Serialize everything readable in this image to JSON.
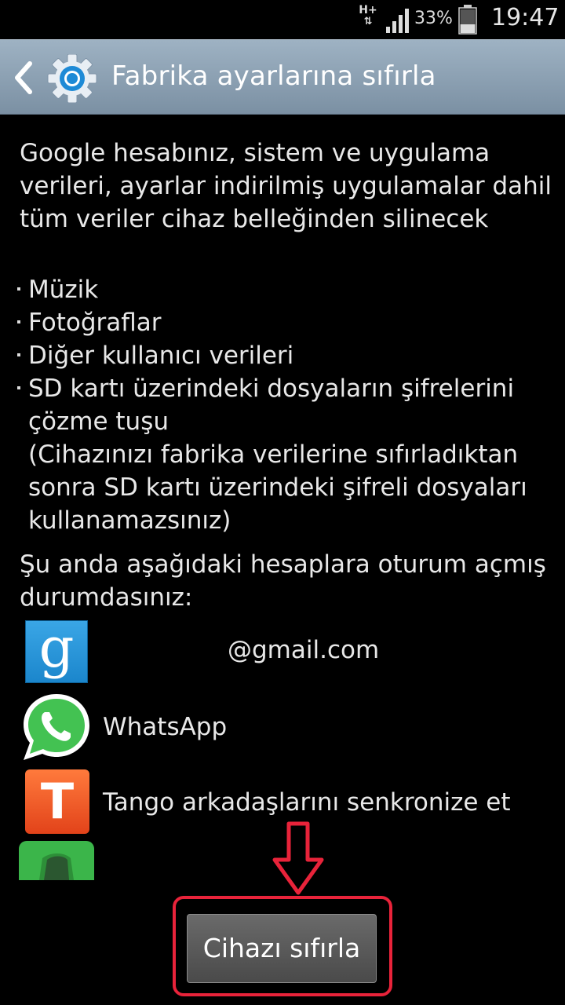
{
  "status_bar": {
    "network": "H+",
    "battery_percent": "33%",
    "time": "19:47"
  },
  "action_bar": {
    "title": "Fabrika ayarlarına sıfırla",
    "back_icon": "back-chevron-icon",
    "app_icon": "settings-gear-icon"
  },
  "content": {
    "intro": "Google hesabınız, sistem ve uygulama verileri, ayarlar indirilmiş uygulamalar dahil tüm veriler cihaz belleğinden silinecek",
    "bullets": [
      {
        "text": "Müzik"
      },
      {
        "text": "Fotoğraflar"
      },
      {
        "text": "Diğer kullanıcı verileri"
      },
      {
        "text": "SD kartı üzerindeki dosyaların şifrelerini çözme tuşu",
        "note": "(Cihazınızı fabrika verilerine sıfırladıktan sonra SD kartı üzerindeki şifreli dosyaları kullanamazsınız)"
      }
    ],
    "logged_in_text": "Şu anda aşağıdaki hesaplara oturum açmış durumdasınız:",
    "accounts": [
      {
        "icon": "google-icon",
        "label": "@gmail.com"
      },
      {
        "icon": "whatsapp-icon",
        "label": "WhatsApp"
      },
      {
        "icon": "tango-icon",
        "label": "Tango arkadaşlarını senkronize et"
      },
      {
        "icon": "evernote-icon",
        "label": ""
      }
    ]
  },
  "reset_button": {
    "label": "Cihazı sıfırla"
  },
  "colors": {
    "action_bar": "#8ea3b6",
    "annotation": "#e8233a",
    "background": "#000000"
  }
}
